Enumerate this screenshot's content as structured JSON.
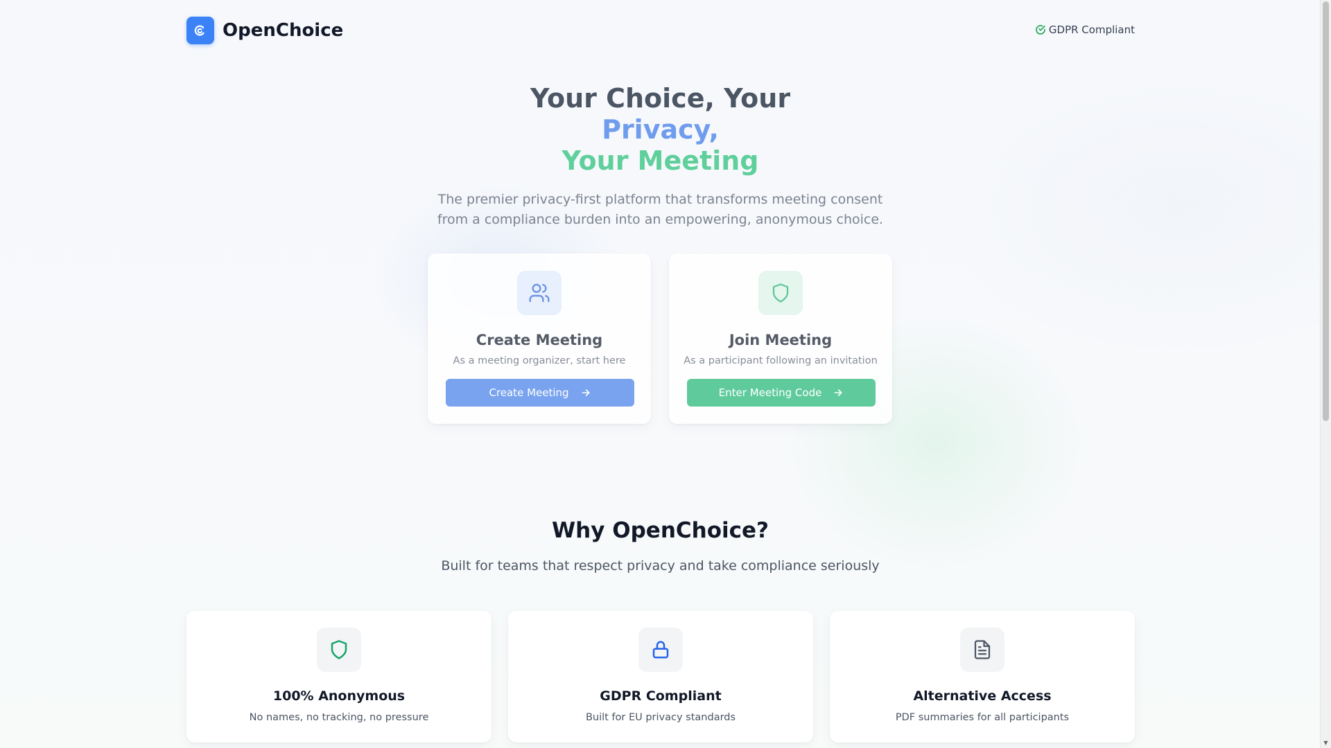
{
  "header": {
    "brand": "OpenChoice",
    "logo_icon": "wave-icon",
    "badge": "GDPR Compliant",
    "badge_icon": "check-circle-icon"
  },
  "hero": {
    "title_line1": "Your Choice, Your",
    "title_line2": "Privacy,",
    "title_line3": "Your Meeting",
    "subtitle": "The premier privacy-first platform that transforms meeting consent from a compliance burden into an empowering, anonymous choice."
  },
  "actions": {
    "create": {
      "icon": "users-icon",
      "title": "Create Meeting",
      "description": "As a meeting organizer, start here",
      "button": "Create Meeting"
    },
    "join": {
      "icon": "shield-icon",
      "title": "Join Meeting",
      "description": "As a participant following an invitation",
      "button": "Enter Meeting Code"
    }
  },
  "why": {
    "title": "Why OpenChoice?",
    "subtitle": "Built for teams that respect privacy and take compliance seriously",
    "features": [
      {
        "icon": "shield-icon",
        "title": "100% Anonymous",
        "description": "No names, no tracking, no pressure"
      },
      {
        "icon": "lock-icon",
        "title": "GDPR Compliant",
        "description": "Built for EU privacy standards"
      },
      {
        "icon": "document-icon",
        "title": "Alternative Access",
        "description": "PDF summaries for all participants"
      }
    ]
  },
  "colors": {
    "brand_blue": "#3b82f6",
    "soft_blue": "#79a3ef",
    "accent_green": "#5fcb9c",
    "text_dark": "#111827"
  }
}
